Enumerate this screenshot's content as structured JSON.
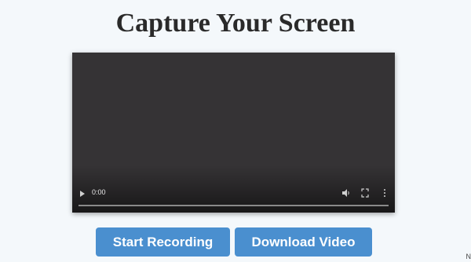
{
  "header": {
    "title": "Capture Your Screen"
  },
  "video_player": {
    "current_time": "0:00",
    "playback_progress": 0,
    "icons": {
      "play": "play-icon",
      "volume": "volume-icon",
      "fullscreen": "fullscreen-icon",
      "more": "more-options-icon"
    },
    "background_color": "#353335"
  },
  "actions": {
    "start_label": "Start Recording",
    "download_label": "Download Video",
    "button_color": "#4a8fcf"
  },
  "corner_text": "N"
}
